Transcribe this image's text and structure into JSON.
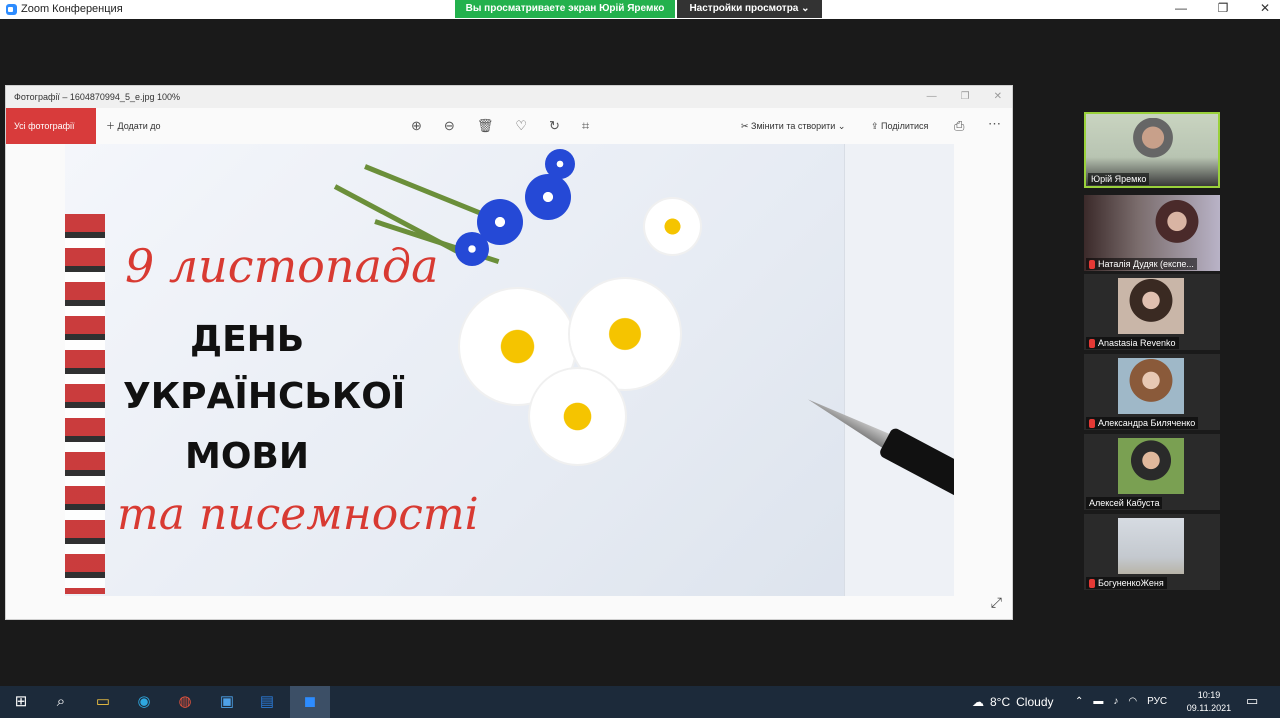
{
  "zoom": {
    "title": "Zoom Конференция",
    "viewing_banner": "Вы просматриваете экран Юрій Яремко",
    "view_options": "Настройки просмотра ⌄",
    "window_buttons": [
      "—",
      "❐",
      "✕"
    ]
  },
  "photos_app": {
    "title": "Фотографії – 1604870994_5_e.jpg   100%",
    "title_controls": [
      "—",
      "❐",
      "✕"
    ],
    "all_photos": "Усі фотографії",
    "add_to": "Додати до",
    "edit_create": "Змінити та створити",
    "share": "Поділитися",
    "toolbar_icons": [
      "zoom-in-icon",
      "zoom-out-icon",
      "delete-icon",
      "favorite-icon",
      "rotate-icon",
      "crop-icon"
    ]
  },
  "image": {
    "line1": "9 листопада",
    "line2": "ДЕНЬ",
    "line3": "УКРАЇНСЬКОЇ",
    "line4": "МОВИ",
    "line5": "та писемності"
  },
  "participants": [
    {
      "name": "Юрій Яремко",
      "muted": false
    },
    {
      "name": "Наталія Дудяк (експе...",
      "muted": true
    },
    {
      "name": "Anastasia Revenko",
      "muted": true
    },
    {
      "name": "Александра Биляченко",
      "muted": true
    },
    {
      "name": "Алексей Кабуста",
      "muted": false
    },
    {
      "name": "БогуненкоЖеня",
      "muted": true
    }
  ],
  "taskbar": {
    "weather_temp": "8°C",
    "weather_text": "Cloudy",
    "lang": "РУС",
    "time": "10:19",
    "date": "09.11.2021"
  },
  "colors": {
    "banner_green": "#23b14d",
    "accent_red": "#d83b3b",
    "active_speaker": "#9ad13b"
  }
}
